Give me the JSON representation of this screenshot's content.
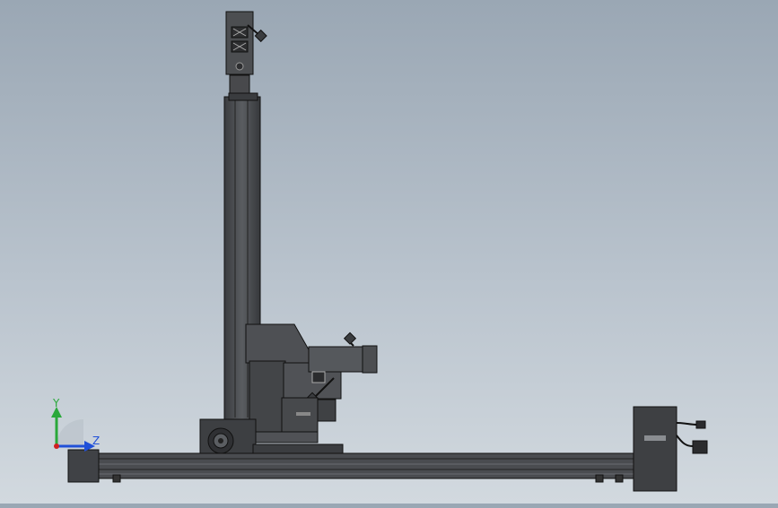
{
  "viewport": {
    "background_top": "#9aa7b4",
    "background_bottom": "#d2d9df"
  },
  "triad": {
    "x_label": "",
    "y_label": "Y",
    "z_label": "Z",
    "y_color": "#2aa83a",
    "z_color": "#2050d8",
    "x_color": "#d02020"
  },
  "model": {
    "name": "",
    "body_color": "#4a4c4f",
    "edge_color": "#111214"
  },
  "icons": {
    "axis_triad": "axis-triad-icon"
  }
}
